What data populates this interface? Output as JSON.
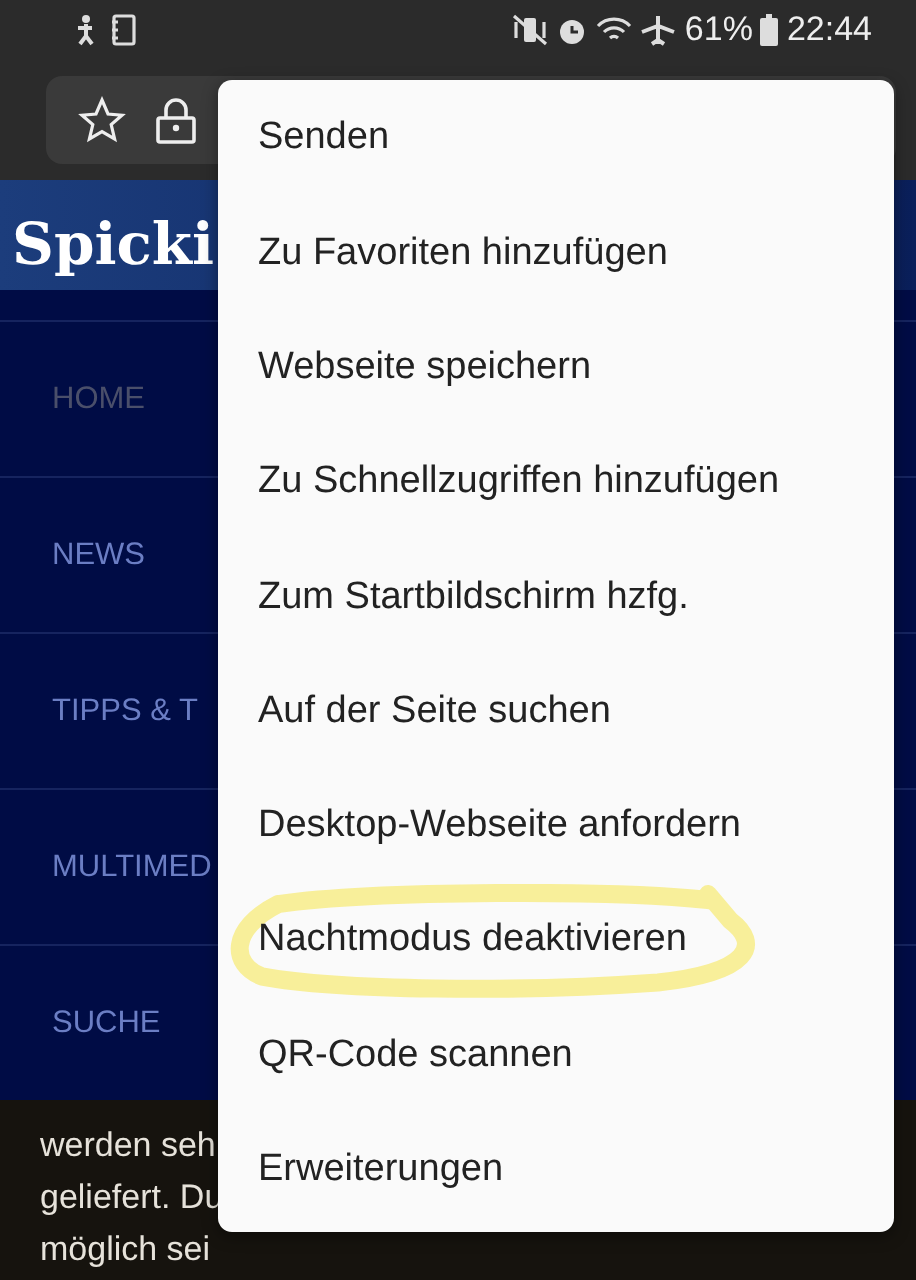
{
  "status_bar": {
    "battery": "61%",
    "time": "22:44"
  },
  "site": {
    "logo": "Spicki",
    "nav": [
      {
        "label": "HOME",
        "selected": true
      },
      {
        "label": "NEWS",
        "selected": false
      },
      {
        "label": "TIPPS & T",
        "selected": false
      },
      {
        "label": "MULTIMED",
        "selected": false
      },
      {
        "label": "SUCHE",
        "selected": false
      }
    ],
    "content_lines": [
      "werden seh",
      "geliefert. Du",
      "möglich sei"
    ]
  },
  "menu": {
    "items": [
      {
        "label": "Senden",
        "annotated": false
      },
      {
        "label": "Zu Favoriten hinzufügen",
        "annotated": false
      },
      {
        "label": "Webseite speichern",
        "annotated": false
      },
      {
        "label": "Zu Schnellzugriffen hinzufügen",
        "annotated": false
      },
      {
        "label": "Zum Startbildschirm hzfg.",
        "annotated": false
      },
      {
        "label": "Auf der Seite suchen",
        "annotated": false
      },
      {
        "label": "Desktop-Webseite anfordern",
        "annotated": false
      },
      {
        "label": "Nachtmodus deaktivieren",
        "annotated": true
      },
      {
        "label": "QR-Code scannen",
        "annotated": false
      },
      {
        "label": "Erweiterungen",
        "annotated": false
      }
    ]
  }
}
